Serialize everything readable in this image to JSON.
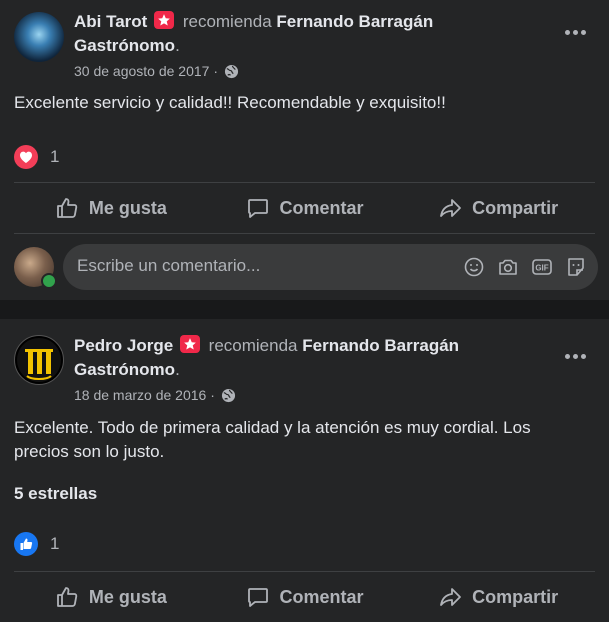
{
  "posts": [
    {
      "author": "Abi Tarot",
      "recommends_text": "recomienda",
      "page_name_line1": "Fernando Barragán",
      "page_name_line2": "Gastrónomo",
      "page_suffix": ".",
      "date": "30 de agosto de 2017 ·",
      "body": "Excelente servicio y calidad!! Recomendable y exquisito!!",
      "reaction": "love",
      "reaction_count": "1",
      "actions": {
        "like": "Me gusta",
        "comment": "Comentar",
        "share": "Compartir"
      },
      "comment_placeholder": "Escribe un comentario..."
    },
    {
      "author": "Pedro Jorge",
      "recommends_text": "recomienda",
      "page_name_line1": "Fernando Barragán",
      "page_name_line2": "Gastrónomo",
      "page_suffix": ".",
      "date": "18 de marzo de 2016 ·",
      "body": "Excelente. Todo de primera calidad y la atención es muy cordial. Los precios son lo justo.",
      "rating_text": "5 estrellas",
      "reaction": "like",
      "reaction_count": "1",
      "actions": {
        "like": "Me gusta",
        "comment": "Comentar",
        "share": "Compartir"
      }
    }
  ],
  "colors": {
    "background": "#18191a",
    "card": "#242526",
    "text_primary": "#e4e6eb",
    "text_secondary": "#b0b3b8",
    "love": "#f33e58",
    "like": "#1877f2",
    "recommend_badge": "#f02849"
  }
}
